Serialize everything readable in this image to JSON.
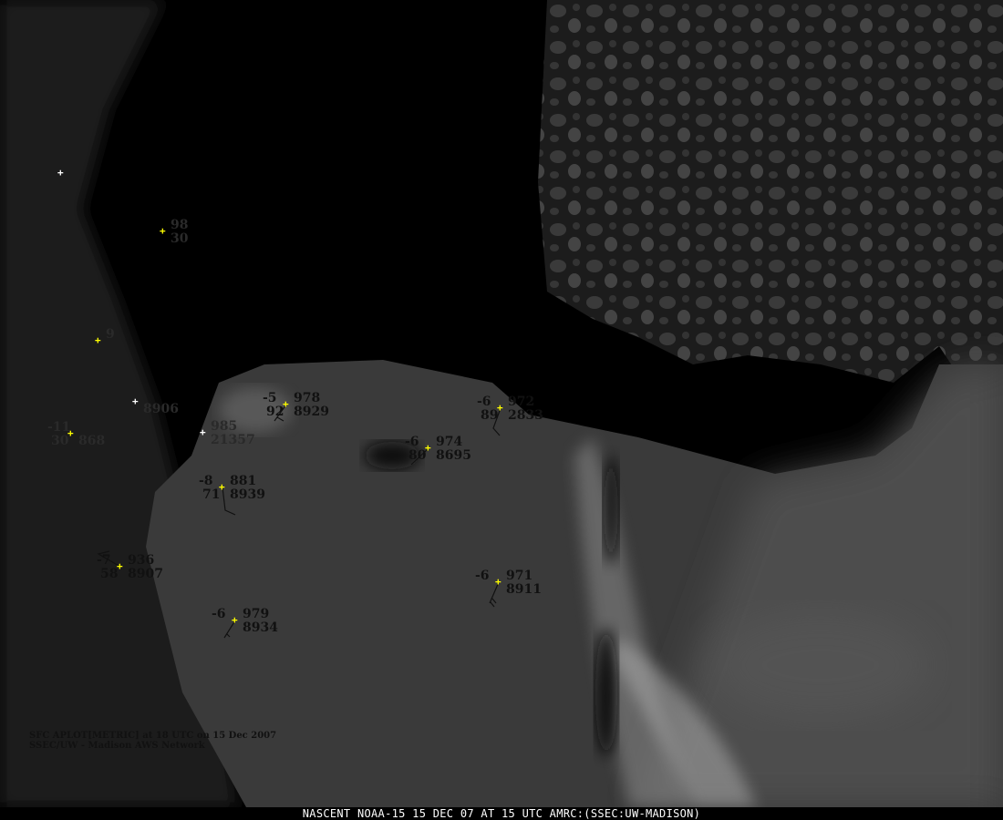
{
  "footer": "NASCENT NOAA-15 15 DEC 07 AT 15 UTC AMRC:(SSEC:UW-MADISON)",
  "legend": {
    "line1": "SFC APLOT[METRIC] at 18 UTC on 15 Dec 2007",
    "line2": "SSEC/UW - Madison AWS Network"
  },
  "colors": {
    "marker": "#ffff00",
    "marker_alt": "#ffffff",
    "text": "#111111"
  },
  "stations": [
    {
      "tl": "",
      "tr": "",
      "bl": "",
      "br": ""
    },
    {
      "tl": "",
      "tr": "98",
      "bl": "",
      "br": "30"
    },
    {
      "tl": "",
      "tr": "9",
      "bl": "",
      "br": ""
    },
    {
      "tl": "",
      "tr": "",
      "bl": "",
      "br": "8906"
    },
    {
      "tl": "-11",
      "tr": "",
      "bl": "30",
      "br": "868"
    },
    {
      "tl": "",
      "tr": "985",
      "bl": "",
      "br": "21357"
    },
    {
      "tl": "-8",
      "tr": "881",
      "bl": "71",
      "br": "8939"
    },
    {
      "tl": "-5",
      "tr": "978",
      "bl": "92",
      "br": "8929"
    },
    {
      "tl": "-6",
      "tr": "972",
      "bl": "89",
      "br": "2833"
    },
    {
      "tl": "-6",
      "tr": "974",
      "bl": "80",
      "br": "8695"
    },
    {
      "tl": "-7",
      "tr": "936",
      "bl": "58",
      "br": "8907"
    },
    {
      "tl": "-6",
      "tr": "979",
      "bl": "",
      "br": "8934"
    },
    {
      "tl": "-6",
      "tr": "971",
      "bl": "",
      "br": "8911"
    }
  ]
}
